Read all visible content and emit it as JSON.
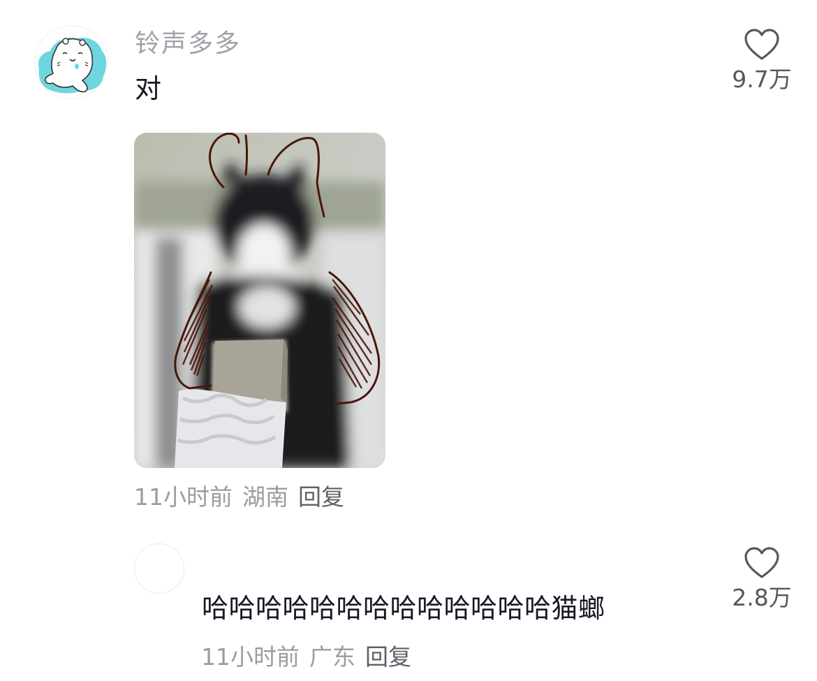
{
  "comment": {
    "username": "铃声多多",
    "text": "对",
    "time": "11小时前",
    "location": "湖南",
    "reply_label": "回复",
    "likes": "9.7万",
    "avatar_icon": "seal-cartoon-avatar",
    "photo": "cat-drawn-as-cockroach-photo"
  },
  "reply": {
    "username": "",
    "text": "哈哈哈哈哈哈哈哈哈哈哈哈哈猫螂",
    "time": "11小时前",
    "location": "广东",
    "reply_label": "回复",
    "likes": "2.8万"
  },
  "colors": {
    "username": "#a0a2a8",
    "meta": "#9a9ca2",
    "text": "#161823",
    "drawing": "#4a1608"
  }
}
